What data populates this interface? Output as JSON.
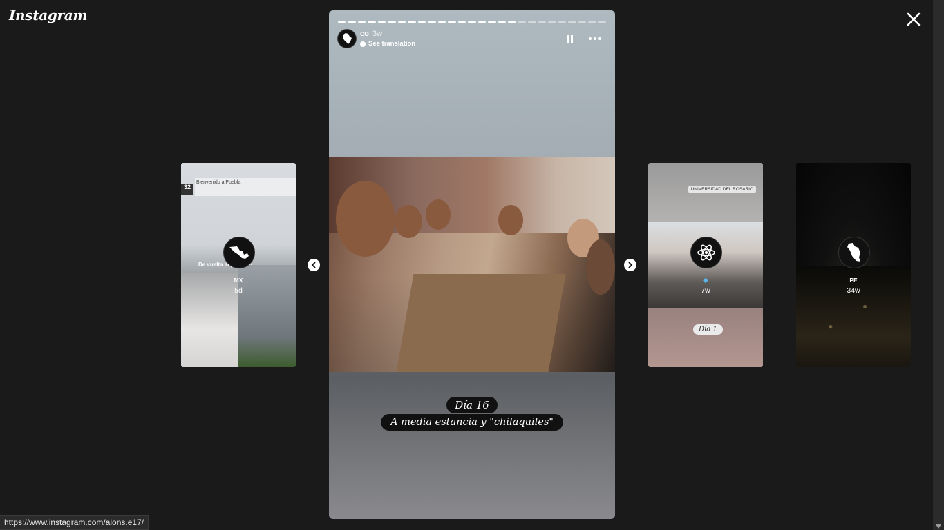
{
  "app": {
    "logo": "Instagram"
  },
  "story": {
    "username": "co",
    "time": "3w",
    "translate_label": "See translation",
    "progress_total": 27,
    "progress_done": 18,
    "caption_line1": "Día 16",
    "caption_line2": "A media estancia y \"chilaquiles\""
  },
  "previews": [
    {
      "name": "MX",
      "time": "5d",
      "sign_text": "Bienvenido a Puebla",
      "number": "32",
      "overlay_text": "De vuelta al pantano"
    },
    {
      "name": "",
      "time": "7w",
      "location_tag": "UNIVERSIDAD DEL ROSARIO",
      "caption": "Día 1"
    },
    {
      "name": "PE",
      "time": "34w"
    }
  ],
  "status_url": "https://www.instagram.com/alons.e17/",
  "colors": {
    "background": "#1a1a1a",
    "accent": "#ffffff"
  },
  "icons": {
    "close": "close-icon",
    "pause": "pause-icon",
    "more": "more-options-icon",
    "prev": "chevron-left-icon",
    "next": "chevron-right-icon"
  }
}
